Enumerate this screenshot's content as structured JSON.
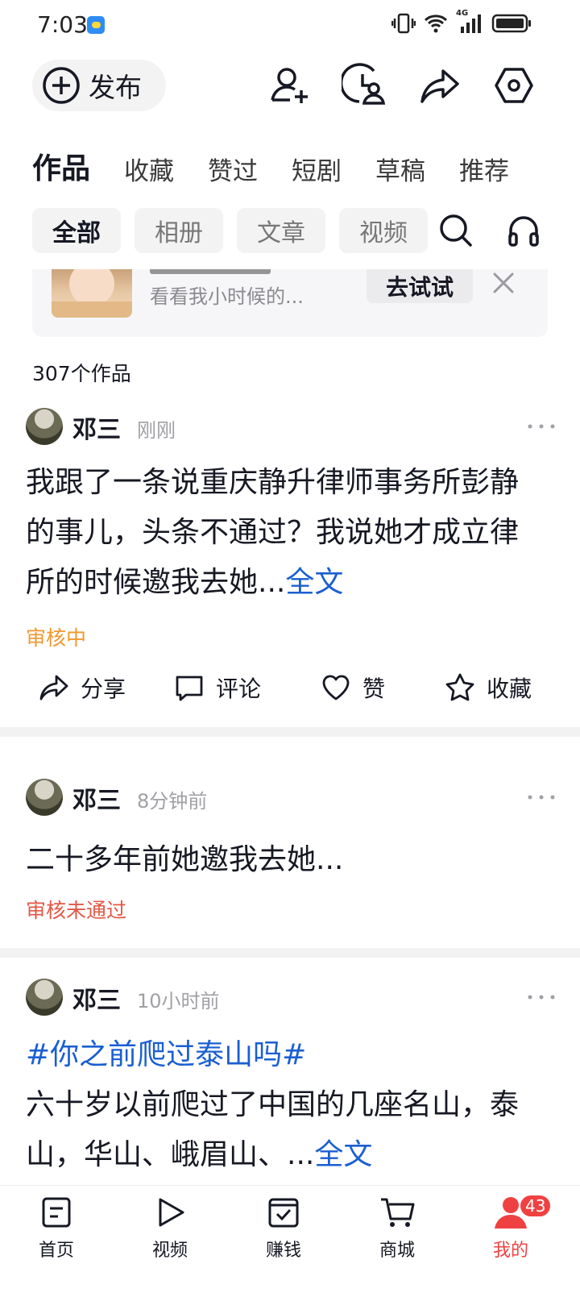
{
  "status_bar": {
    "time": "7:03",
    "network": "4G"
  },
  "top_bar": {
    "publish_label": "发布",
    "icons": [
      "add-friend-icon",
      "visitor-history-icon",
      "share-icon",
      "settings-icon"
    ]
  },
  "main_tabs": [
    {
      "label": "作品",
      "active": true
    },
    {
      "label": "收藏",
      "active": false
    },
    {
      "label": "赞过",
      "active": false
    },
    {
      "label": "短剧",
      "active": false
    },
    {
      "label": "草稿",
      "active": false
    },
    {
      "label": "推荐",
      "active": false
    }
  ],
  "filters": [
    {
      "label": "全部",
      "active": true
    },
    {
      "label": "相册",
      "active": false
    },
    {
      "label": "文章",
      "active": false
    },
    {
      "label": "视频",
      "active": false
    }
  ],
  "promo": {
    "subtitle": "看看我小时候的...",
    "try_label": "去试试"
  },
  "works_count": "307个作品",
  "posts": [
    {
      "author": "邓三",
      "time": "刚刚",
      "text": "我跟了一条说重庆静升律师事务所彭静的事儿，头条不通过？我说她才成立律所的时候邀我去她...",
      "full_link": "全文",
      "status": "审核中",
      "actions": {
        "share": "分享",
        "comment": "评论",
        "like": "赞",
        "favorite": "收藏"
      }
    },
    {
      "author": "邓三",
      "time": "8分钟前",
      "text": "二十多年前她邀我去她...",
      "status": "审核未通过"
    },
    {
      "author": "邓三",
      "time": "10小时前",
      "hashtag": "#你之前爬过泰山吗#",
      "text": "六十岁以前爬过了中国的几座名山，泰山，华山、峨眉山、...",
      "full_link": "全文"
    }
  ],
  "bottom_nav": [
    {
      "label": "首页",
      "icon": "home-icon"
    },
    {
      "label": "视频",
      "icon": "play-icon"
    },
    {
      "label": "赚钱",
      "icon": "earn-icon"
    },
    {
      "label": "商城",
      "icon": "cart-icon"
    },
    {
      "label": "我的",
      "icon": "profile-icon",
      "active": true,
      "badge": "43"
    }
  ],
  "colors": {
    "accent_red": "#f04142",
    "link_blue": "#1a5fd1",
    "pending_orange": "#f0982e",
    "rejected_red": "#e45745"
  }
}
